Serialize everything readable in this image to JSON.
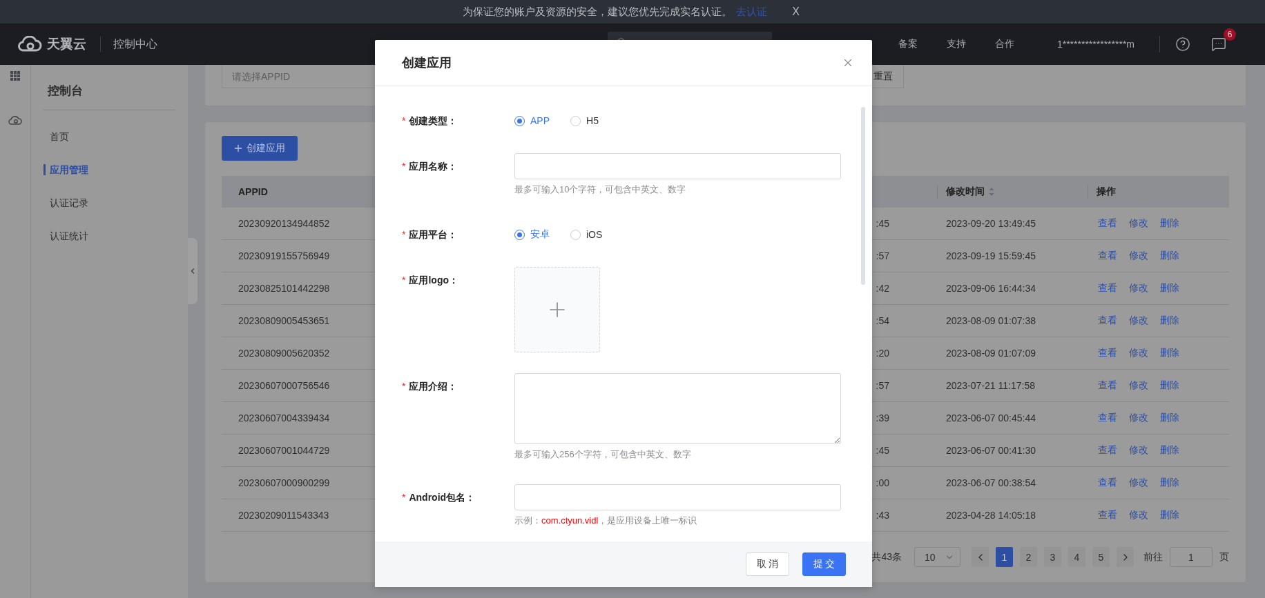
{
  "notice": {
    "text": "为保证您的账户及资源的安全，建议您优先完成实名认证。",
    "link": "去认证",
    "close": "X"
  },
  "header": {
    "brand": "天翼云",
    "section": "控制中心",
    "nav": [
      "备案",
      "支持",
      "合作"
    ],
    "user": "1*****************m",
    "message_count": "6"
  },
  "sidebar": {
    "title": "控制台",
    "items": [
      {
        "label": "首页",
        "selected": false
      },
      {
        "label": "应用管理",
        "selected": true
      },
      {
        "label": "认证记录",
        "selected": false
      },
      {
        "label": "认证统计",
        "selected": false
      }
    ]
  },
  "filter": {
    "placeholder": "请选择APPID",
    "reset": "重置"
  },
  "create_button": "创建应用",
  "table": {
    "columns": [
      {
        "label": "APPID",
        "sortable": false
      },
      {
        "label": "修改时间",
        "sortable": true
      },
      {
        "label": "操作",
        "sortable": false
      }
    ],
    "rows": [
      {
        "appid": "20230920134944852",
        "column_2": ":45",
        "modified": "2023-09-20 13:49:45",
        "actions": [
          "查看",
          "修改",
          "删除"
        ]
      },
      {
        "appid": "20230919155756949",
        "column_2": ":57",
        "modified": "2023-09-19 15:59:45",
        "actions": [
          "查看",
          "修改",
          "删除"
        ]
      },
      {
        "appid": "20230825101442298",
        "column_2": ":42",
        "modified": "2023-09-06 16:44:34",
        "actions": [
          "查看",
          "修改",
          "删除"
        ]
      },
      {
        "appid": "20230809005453651",
        "column_2": ":54",
        "modified": "2023-08-09 01:07:38",
        "actions": [
          "查看",
          "修改",
          "删除"
        ]
      },
      {
        "appid": "20230809005620352",
        "column_2": ":20",
        "modified": "2023-08-09 01:07:09",
        "actions": [
          "查看",
          "修改",
          "删除"
        ]
      },
      {
        "appid": "20230607000756546",
        "column_2": ":57",
        "modified": "2023-07-21 11:17:58",
        "actions": [
          "查看",
          "修改",
          "删除"
        ]
      },
      {
        "appid": "20230607004339434",
        "column_2": ":39",
        "modified": "2023-06-07 00:45:44",
        "actions": [
          "查看",
          "修改",
          "删除"
        ]
      },
      {
        "appid": "20230607001044729",
        "column_2": ":45",
        "modified": "2023-06-07 00:41:30",
        "actions": [
          "查看",
          "修改",
          "删除"
        ]
      },
      {
        "appid": "20230607000900299",
        "column_2": ":00",
        "modified": "2023-06-07 00:38:54",
        "actions": [
          "查看",
          "修改",
          "删除"
        ]
      },
      {
        "appid": "20230209011543343",
        "column_2": ":43",
        "modified": "2023-04-28 14:05:18",
        "actions": [
          "查看",
          "修改",
          "删除"
        ]
      }
    ]
  },
  "pagination": {
    "total": "共43条",
    "page_size": "10",
    "pages": [
      {
        "label": "1",
        "selected": true
      },
      {
        "label": "2",
        "selected": false
      },
      {
        "label": "3",
        "selected": false
      },
      {
        "label": "4",
        "selected": false
      },
      {
        "label": "5",
        "selected": false
      }
    ],
    "goto_label": "前往",
    "goto_value": "1",
    "page_suffix": "页"
  },
  "modal": {
    "title": "创建应用",
    "fields": [
      {
        "kind": "radio",
        "mark": "*",
        "label": "创建类型：",
        "options": [
          {
            "label": "APP",
            "selected": true
          },
          {
            "label": "H5",
            "selected": false
          }
        ]
      },
      {
        "kind": "input",
        "mark": "*",
        "label": "应用名称：",
        "hint": [
          {
            "kind": "plain",
            "text": "最多可输入10个字符，可包含中英文、数字"
          }
        ]
      },
      {
        "kind": "radio",
        "mark": "*",
        "label": "应用平台：",
        "options": [
          {
            "label": "安卓",
            "selected": true
          },
          {
            "label": "iOS",
            "selected": false
          }
        ]
      },
      {
        "kind": "upload",
        "mark": "*",
        "label": "应用logo："
      },
      {
        "kind": "textarea",
        "mark": "*",
        "label": "应用介绍：",
        "hint": [
          {
            "kind": "plain",
            "text": "最多可输入256个字符，可包含中英文、数字"
          }
        ]
      },
      {
        "kind": "input",
        "mark": "*",
        "label": "Android包名：",
        "hint": [
          {
            "kind": "plain",
            "text": "示例："
          },
          {
            "kind": "example",
            "text": "com.ctyun.vidl"
          },
          {
            "kind": "plain",
            "text": "，是应用设备上唯一标识"
          }
        ]
      }
    ],
    "buttons": [
      {
        "label": "取 消",
        "kind": "secondary"
      },
      {
        "label": "提 交",
        "kind": "primary"
      }
    ]
  }
}
